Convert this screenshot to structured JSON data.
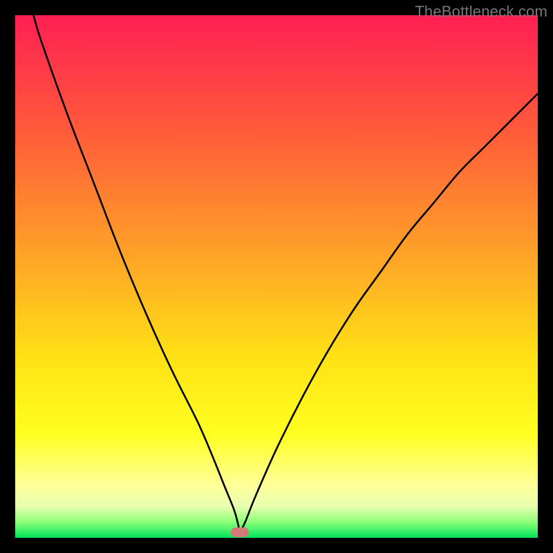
{
  "watermark": "TheBottleneck.com",
  "chart_data": {
    "type": "line",
    "title": "",
    "xlabel": "",
    "ylabel": "",
    "xlim": [
      0,
      100
    ],
    "ylim": [
      0,
      100
    ],
    "grid": false,
    "legend": false,
    "curve_description": "V-shaped absolute-value-like curve with a cusp minimum near x≈43, y≈0; left branch rises steeply nearly vertically toward the top-left corner; right branch rises concavely toward the right edge ending near y≈85",
    "x": [
      3.5,
      5,
      10,
      15,
      20,
      25,
      30,
      35,
      38,
      40,
      42,
      43,
      44,
      46,
      50,
      55,
      60,
      65,
      70,
      75,
      80,
      85,
      90,
      95,
      100
    ],
    "y": [
      100,
      95,
      81,
      68,
      55,
      43,
      32,
      22,
      15,
      10,
      5,
      1,
      3,
      8,
      17,
      27,
      36,
      44,
      51,
      58,
      64,
      70,
      75,
      80,
      85
    ],
    "min_marker": {
      "x": 43,
      "y": 1,
      "color": "#d47a78",
      "shape": "rounded-rect"
    },
    "colors": {
      "background_black": "#000000",
      "gradient_top": "#ff1f54",
      "gradient_mid_upper": "#ff6a2f",
      "gradient_mid": "#ffc618",
      "gradient_mid_lower": "#fff200",
      "gradient_lower_yellow": "#ffff8a",
      "gradient_green_light": "#7dff66",
      "gradient_green": "#00e45a",
      "curve_stroke": "#000000"
    }
  }
}
